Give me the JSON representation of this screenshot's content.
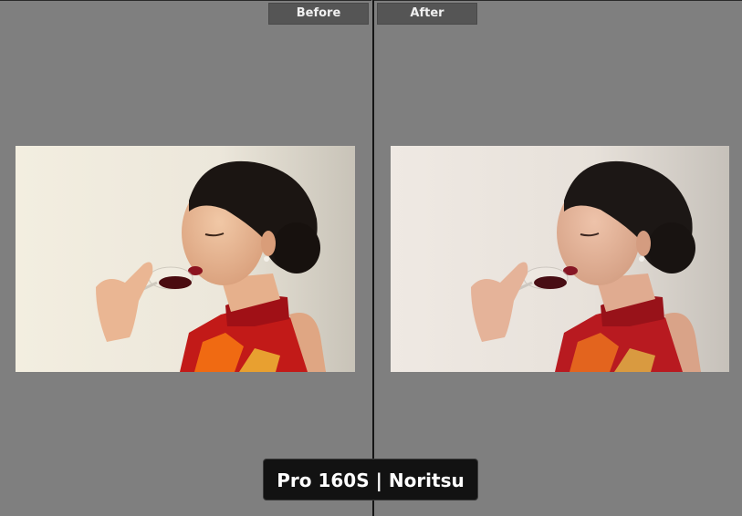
{
  "compare_view": {
    "before_label": "Before",
    "after_label": "After",
    "preset_name": "Pro 160S | Noritsu"
  },
  "colors": {
    "background": "#7f7f7f",
    "tab_background": "#555555",
    "overlay_background": "#121212",
    "divider": "#151515"
  }
}
